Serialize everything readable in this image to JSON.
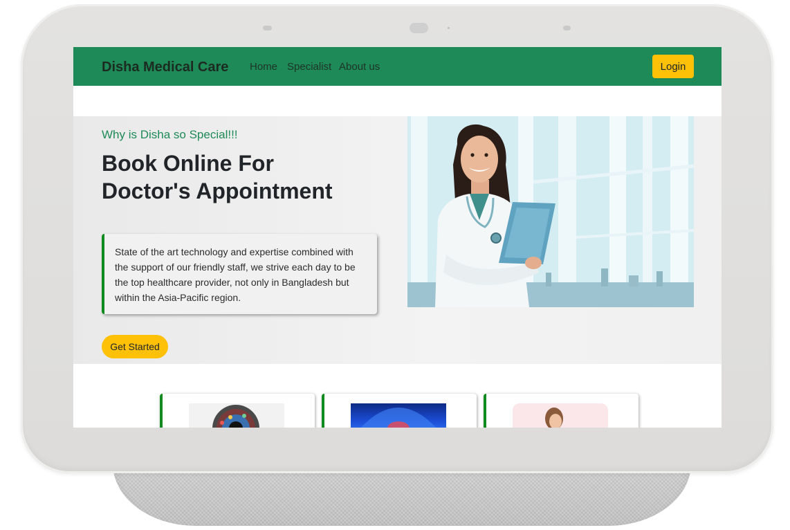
{
  "navbar": {
    "brand": "Disha Medical Care",
    "links": [
      "Home",
      "Specialist",
      "About us"
    ],
    "login_label": "Login"
  },
  "hero": {
    "tagline": "Why is Disha so Special!!!",
    "title_line1": "Book Online For",
    "title_line2": "Doctor's Appointment",
    "description": "State of the art technology and expertise combined with the support of our friendly staff, we strive each day to be the top healthcare provider, not only in Bangladesh but within the Asia-Pacific region.",
    "cta_label": "Get Started",
    "image": "doctor-with-clipboard"
  },
  "specialists": {
    "cards": [
      {
        "image": "eye-illustration"
      },
      {
        "image": "body-xray-illustration"
      },
      {
        "image": "woman-illustration"
      }
    ]
  },
  "colors": {
    "navbar": "#1e8a57",
    "accent": "#ffc107",
    "card_border": "#118a1f",
    "tagline": "#1e8a57"
  }
}
